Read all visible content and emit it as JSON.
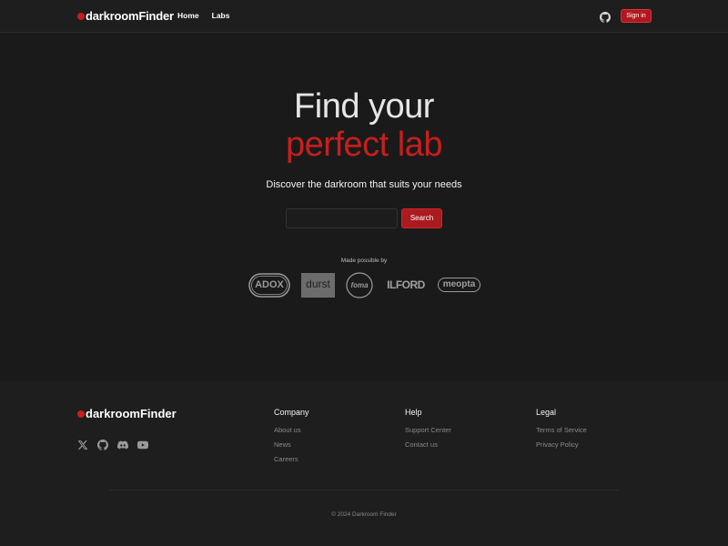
{
  "header": {
    "brand": "darkroomFinder",
    "nav": [
      "Home",
      "Labs"
    ],
    "signin_label": "Sign in"
  },
  "hero": {
    "line1": "Find your",
    "line2": "perfect lab",
    "subtitle": "Discover the darkroom that suits your needs",
    "search_placeholder": "",
    "search_label": "Search"
  },
  "sponsors": {
    "label": "Made possible by",
    "logos": [
      "ADOX",
      "durst",
      "foma",
      "ILFORD",
      "meopta"
    ]
  },
  "footer": {
    "brand": "darkroomFinder",
    "social_icons": [
      "x-icon",
      "github-icon",
      "discord-icon",
      "youtube-icon"
    ],
    "columns": [
      {
        "title": "Company",
        "links": [
          "About us",
          "News",
          "Careers"
        ]
      },
      {
        "title": "Help",
        "links": [
          "Support Center",
          "Contact us"
        ]
      },
      {
        "title": "Legal",
        "links": [
          "Terms of Service",
          "Privacy Policy"
        ]
      }
    ],
    "copyright": "© 2024 Darkroom Finder"
  },
  "colors": {
    "background": "#1a1a1a",
    "accent": "#c81e1e",
    "text": "#ffffff",
    "muted": "#8a8a8a"
  }
}
